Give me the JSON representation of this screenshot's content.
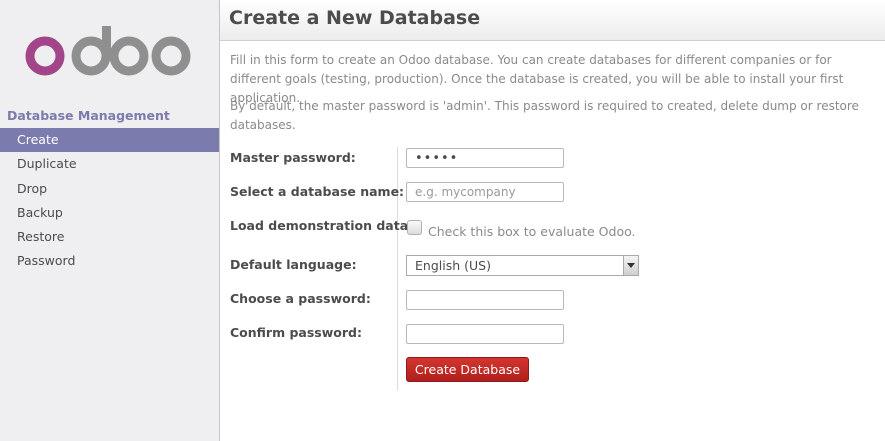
{
  "app": {
    "logo_text": "odoo",
    "colors": {
      "logo_o": "#a24689",
      "logo_rest": "#8f8f8f",
      "accent": "#7c7bad",
      "button": "#c22a25"
    }
  },
  "sidebar": {
    "title": "Database Management",
    "items": [
      {
        "label": "Create",
        "active": true
      },
      {
        "label": "Duplicate"
      },
      {
        "label": "Drop"
      },
      {
        "label": "Backup"
      },
      {
        "label": "Restore"
      },
      {
        "label": "Password"
      }
    ]
  },
  "header": {
    "title": "Create a New Database"
  },
  "intro": {
    "p1": "Fill in this form to create an Odoo database. You can create databases for different companies or for different goals (testing, production). Once the database is created, you will be able to install your first application.",
    "p2": "By default, the master password is 'admin'. This password is required to created, delete dump or restore databases."
  },
  "form": {
    "master_password": {
      "label": "Master password:",
      "value": "admin"
    },
    "db_name": {
      "label": "Select a database name:",
      "placeholder": "e.g. mycompany",
      "value": ""
    },
    "demo": {
      "label": "Load demonstration data:",
      "text": "Check this box to evaluate Odoo.",
      "checked": false
    },
    "language": {
      "label": "Default language:",
      "value": "English (US)"
    },
    "password": {
      "label": "Choose a password:",
      "value": ""
    },
    "confirm": {
      "label": "Confirm password:",
      "value": ""
    },
    "submit_label": "Create Database"
  }
}
